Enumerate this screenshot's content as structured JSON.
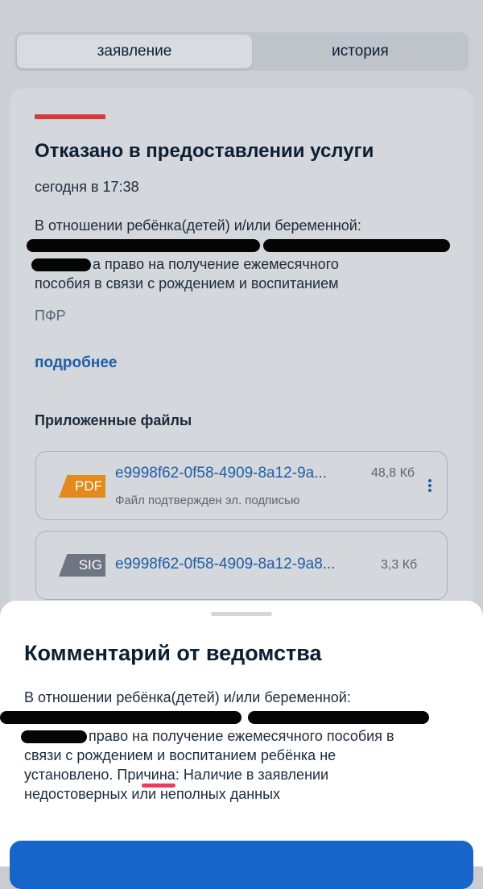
{
  "tabs": [
    {
      "label": "заявление",
      "active": true
    },
    {
      "label": "история",
      "active": false
    }
  ],
  "status": {
    "title": "Отказано в предоставлении услуги",
    "time": "сегодня в 17:38",
    "description_line1": "В отношении ребёнка(детей) и/или беременной:",
    "description_line3": "а право на получение ежемесячного",
    "description_line4": "пособия в связи с рождением и воспитанием",
    "department": "ПФР",
    "more_link": "подробнее",
    "accent_color": "#d33a3c"
  },
  "files": {
    "title": "Приложенные файлы",
    "items": [
      {
        "badge": "PDF",
        "name": "e9998f62-0f58-4909-8a12-9a...",
        "size": "48,8 Кб",
        "subtitle": "Файл подтвержден эл. подписью",
        "badge_color": "#e28a1b",
        "icon": "more-vertical-icon"
      },
      {
        "badge": "SIG",
        "name": "e9998f62-0f58-4909-8a12-9a8...",
        "size": "3,3 Кб",
        "badge_color": "#6c7581"
      }
    ]
  },
  "sheet": {
    "title": "Комментарий от ведомства",
    "text_line1": "В отношении ребёнка(детей) и/или беременной:",
    "text_line3": "право на получение ежемесячного пособия в",
    "text_line4": "связи с рождением и воспитанием ребёнка не",
    "text_line5_before": "установлено. При",
    "text_line5_marked": "чина",
    "text_line5_after": ": Наличие в заявлении",
    "text_line6": "недостоверных или неполных данных",
    "button_color": "#1765c8"
  }
}
